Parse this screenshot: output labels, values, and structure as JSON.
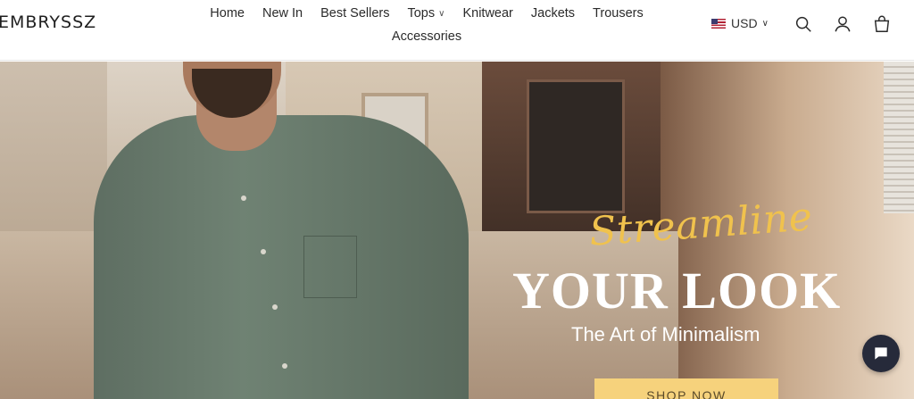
{
  "header": {
    "logo": "EMBRYSSZ",
    "nav": [
      {
        "label": "Home"
      },
      {
        "label": "New In"
      },
      {
        "label": "Best Sellers"
      },
      {
        "label": "Tops",
        "has_dropdown": true
      },
      {
        "label": "Knitwear"
      },
      {
        "label": "Jackets"
      },
      {
        "label": "Trousers"
      },
      {
        "label": "Accessories"
      }
    ],
    "currency": {
      "value": "USD",
      "flag_icon": "us-flag-icon"
    },
    "icons": [
      "search-icon",
      "account-icon",
      "cart-icon"
    ]
  },
  "hero": {
    "script_text": "Streamline",
    "headline": "YOUR LOOK",
    "subheadline": "The Art of Minimalism",
    "cta_label": "SHOP NOW",
    "colors": {
      "script": "#f0c24d",
      "cta": "#f6d27c"
    }
  },
  "chat": {
    "icon": "chat-icon"
  }
}
